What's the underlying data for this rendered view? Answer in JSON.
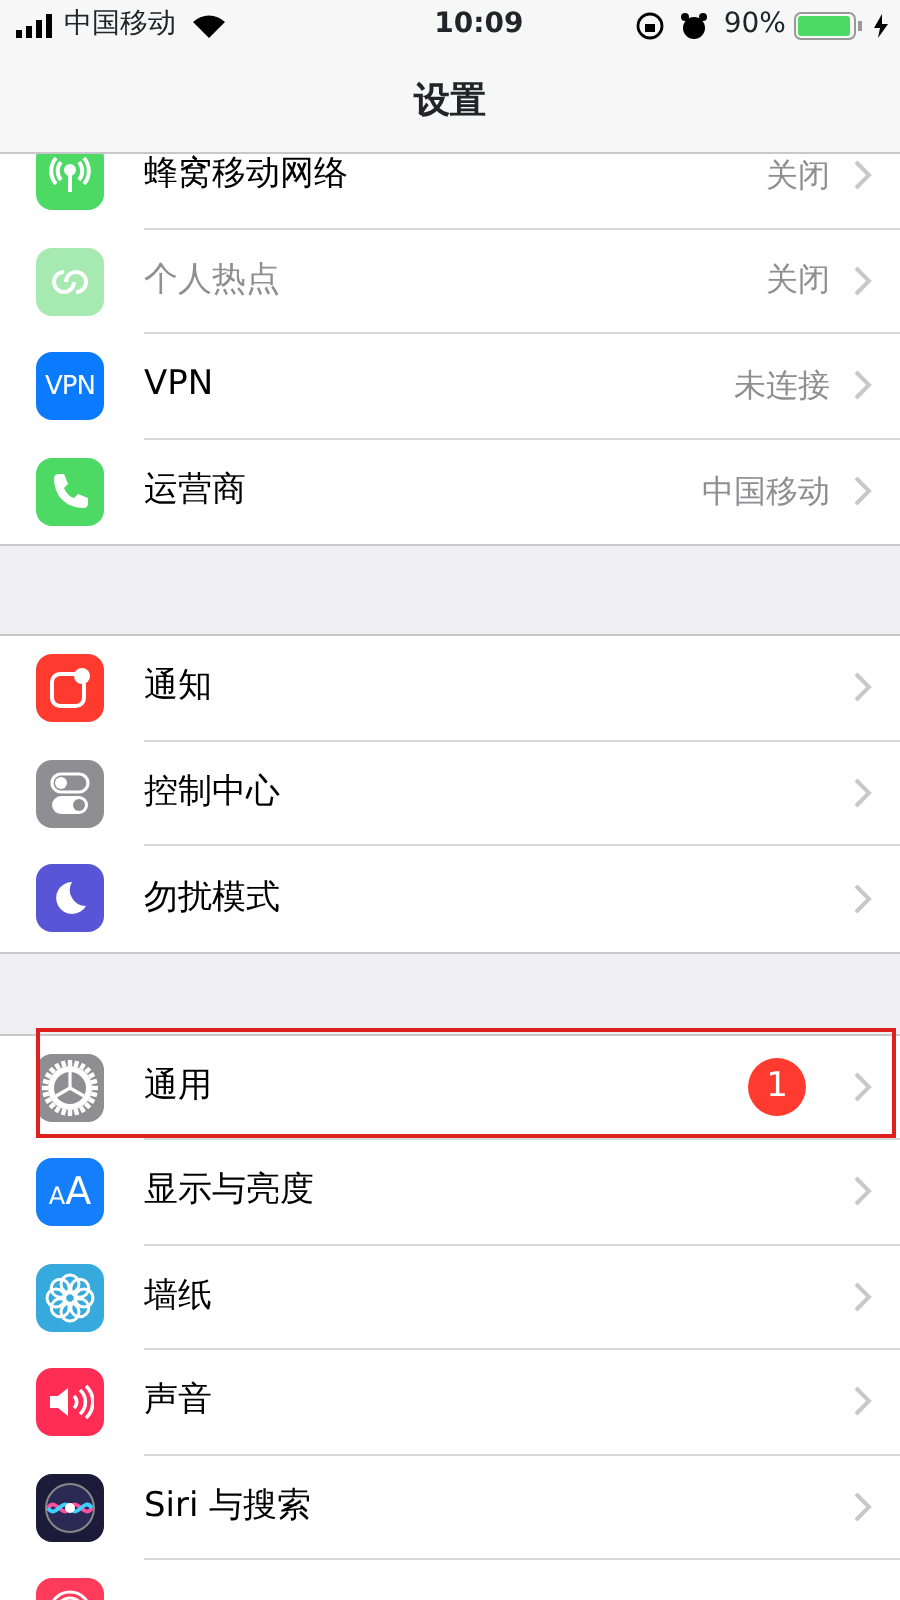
{
  "status_bar": {
    "carrier": "中国移动",
    "time": "10:09",
    "battery": "90%"
  },
  "nav": {
    "title": "设置"
  },
  "sections": [
    {
      "rows": [
        {
          "kind": "cellular",
          "color": "#4cd964",
          "label": "蜂窝移动网络",
          "value": "关闭",
          "disabled": false,
          "highlighted": false
        },
        {
          "kind": "hotspot",
          "color": "#a6e9b1",
          "label": "个人热点",
          "value": "关闭",
          "disabled": true,
          "highlighted": false
        },
        {
          "kind": "vpn",
          "color": "#0a7aff",
          "icon_text": "VPN",
          "label": "VPN",
          "value": "未连接",
          "disabled": false,
          "highlighted": false
        },
        {
          "kind": "phone",
          "color": "#4cd964",
          "label": "运营商",
          "value": "中国移动",
          "disabled": false,
          "highlighted": false
        }
      ]
    },
    {
      "rows": [
        {
          "kind": "notifications",
          "color": "#ff3b30",
          "label": "通知",
          "disabled": false,
          "highlighted": false
        },
        {
          "kind": "toggles",
          "color": "#8e8e93",
          "label": "控制中心",
          "disabled": false,
          "highlighted": false
        },
        {
          "kind": "moon",
          "color": "#5856d6",
          "label": "勿扰模式",
          "disabled": false,
          "highlighted": false
        }
      ]
    },
    {
      "rows": [
        {
          "kind": "gear",
          "color": "#8e8e93",
          "label": "通用",
          "badge": "1",
          "disabled": false,
          "highlighted": true
        },
        {
          "kind": "text",
          "color": "#147efb",
          "icon_text": "AA",
          "label": "显示与亮度",
          "disabled": false,
          "highlighted": false
        },
        {
          "kind": "flower",
          "color": "#36aadc",
          "label": "墙纸",
          "disabled": false,
          "highlighted": false
        },
        {
          "kind": "speaker",
          "color": "#ff2d55",
          "label": "声音",
          "disabled": false,
          "highlighted": false
        },
        {
          "kind": "siri",
          "color": "#1c1c3a",
          "label": "Siri 与搜索",
          "disabled": false,
          "highlighted": false
        },
        {
          "kind": "fingerprint",
          "color": "#ff3b5c",
          "highlighted": false
        }
      ]
    }
  ]
}
